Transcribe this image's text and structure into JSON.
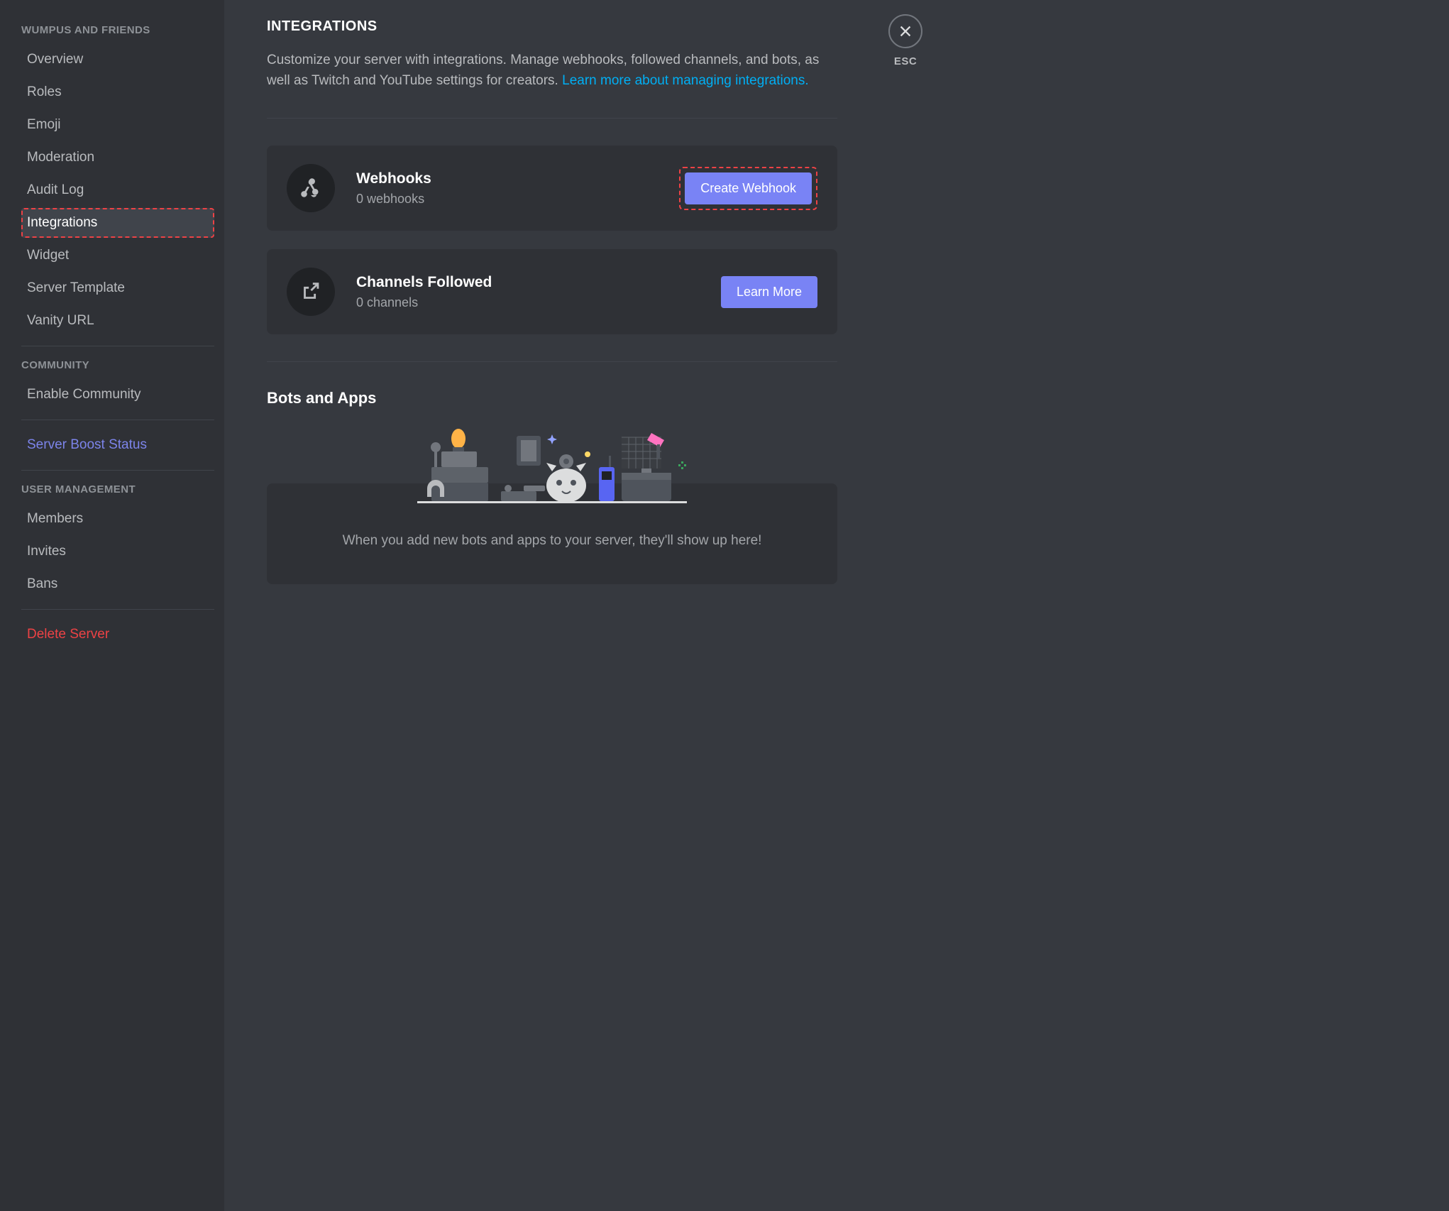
{
  "sidebar": {
    "sections": [
      {
        "header": "WUMPUS AND FRIENDS",
        "items": [
          {
            "label": "Overview",
            "name": "sidebar-item-overview"
          },
          {
            "label": "Roles",
            "name": "sidebar-item-roles"
          },
          {
            "label": "Emoji",
            "name": "sidebar-item-emoji"
          },
          {
            "label": "Moderation",
            "name": "sidebar-item-moderation"
          },
          {
            "label": "Audit Log",
            "name": "sidebar-item-audit-log"
          },
          {
            "label": "Integrations",
            "name": "sidebar-item-integrations",
            "selected": true
          },
          {
            "label": "Widget",
            "name": "sidebar-item-widget"
          },
          {
            "label": "Server Template",
            "name": "sidebar-item-server-template"
          },
          {
            "label": "Vanity URL",
            "name": "sidebar-item-vanity-url"
          }
        ]
      },
      {
        "header": "COMMUNITY",
        "items": [
          {
            "label": "Enable Community",
            "name": "sidebar-item-enable-community"
          }
        ]
      },
      {
        "items": [
          {
            "label": "Server Boost Status",
            "name": "sidebar-item-boost-status",
            "style": "boost"
          }
        ]
      },
      {
        "header": "USER MANAGEMENT",
        "items": [
          {
            "label": "Members",
            "name": "sidebar-item-members"
          },
          {
            "label": "Invites",
            "name": "sidebar-item-invites"
          },
          {
            "label": "Bans",
            "name": "sidebar-item-bans"
          }
        ]
      },
      {
        "items": [
          {
            "label": "Delete Server",
            "name": "sidebar-item-delete-server",
            "style": "danger"
          }
        ]
      }
    ]
  },
  "main": {
    "title": "INTEGRATIONS",
    "description_pre": "Customize your server with integrations. Manage webhooks, followed channels, and bots, as well as Twitch and YouTube settings for creators. ",
    "description_link": "Learn more about managing integrations.",
    "cards": {
      "webhooks": {
        "title": "Webhooks",
        "sub": "0 webhooks",
        "button": "Create Webhook"
      },
      "channels": {
        "title": "Channels Followed",
        "sub": "0 channels",
        "button": "Learn More"
      }
    },
    "bots": {
      "title": "Bots and Apps",
      "empty_text": "When you add new bots and apps to your server, they'll show up here!"
    }
  },
  "close": {
    "label": "ESC"
  }
}
